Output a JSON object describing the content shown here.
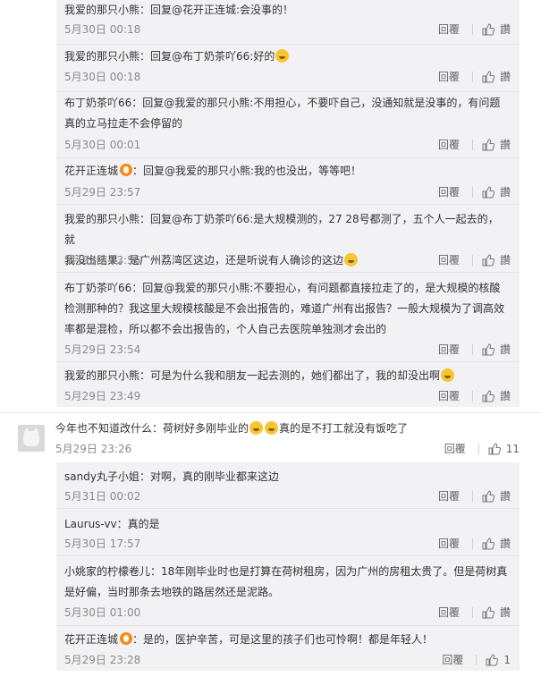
{
  "labels": {
    "reply": "回覆",
    "like": "讚"
  },
  "thread1": [
    {
      "name": "我爱的那只小熊",
      "body": "：回复@花开正连城:会没事的！",
      "time": "5月30日 00:18"
    },
    {
      "name": "我爱的那只小熊",
      "body": "：回复@布丁奶茶吖66:好的",
      "time": "5月30日 00:18"
    },
    {
      "name": "布丁奶茶吖66",
      "body": "：回复@我爱的那只小熊:不用担心，不要吓自己，没通知就是没事的，有问题",
      "body2": "真的立马拉走不会停留的",
      "time": "5月30日 00:01"
    },
    {
      "name": "花开正连城",
      "body": "：回复@我爱的那只小熊:我的也没出，等等吧！",
      "time": "5月29日 23:57"
    },
    {
      "name": "我爱的那只小熊",
      "body": "：回复@布丁奶茶吖66:是大规模测的，27 28号都测了，五个人一起去的，就",
      "body2": "我没出结果。是广州荔湾区这边，还是听说有人确诊的这边",
      "time": "5月29日 23:56"
    },
    {
      "name": "布丁奶茶吖66",
      "body": "：回复@我爱的那只小熊:不要担心，有问题都直接拉走了的，是大规模的核酸",
      "body2": "检测那种的？我这里大规模核酸是不会出报告的，难道广州有出报告？一般大规模为了调高效",
      "body3": "率都是混检，所以都不会出报告的，个人自己去医院单独测才会出的",
      "time": "5月29日 23:54"
    },
    {
      "name": "我爱的那只小熊",
      "body": "：可是为什么我和朋友一起去测的，她们都出了，我的却没出啊",
      "time": "5月29日 23:49"
    }
  ],
  "comment": {
    "name": "今年也不知道改什么",
    "body": "：荷树好多刚毕业的",
    "body_end": "真的是不打工就没有饭吃了",
    "time": "5月29日 23:26",
    "likes": "11"
  },
  "thread2": [
    {
      "name": "sandy丸子小姐",
      "body": "：对啊，真的刚毕业都来这边",
      "time": "5月31日 00:02"
    },
    {
      "name": "Laurus-vv",
      "body": "：真的是",
      "time": "5月30日 17:57"
    },
    {
      "name": "小姚家的柠檬卷儿",
      "body": "：18年刚毕业时也是打算在荷树租房，因为广州的房租太贵了。但是荷树真",
      "body2": "是好偏，当时那条去地铁的路居然还是泥路。",
      "time": "5月30日 01:00"
    },
    {
      "name": "花开正连城",
      "body": "：是的，医护辛苦，可是这里的孩子们也可怜啊！都是年轻人！",
      "time": "5月29日 23:28",
      "likes": "1"
    }
  ]
}
